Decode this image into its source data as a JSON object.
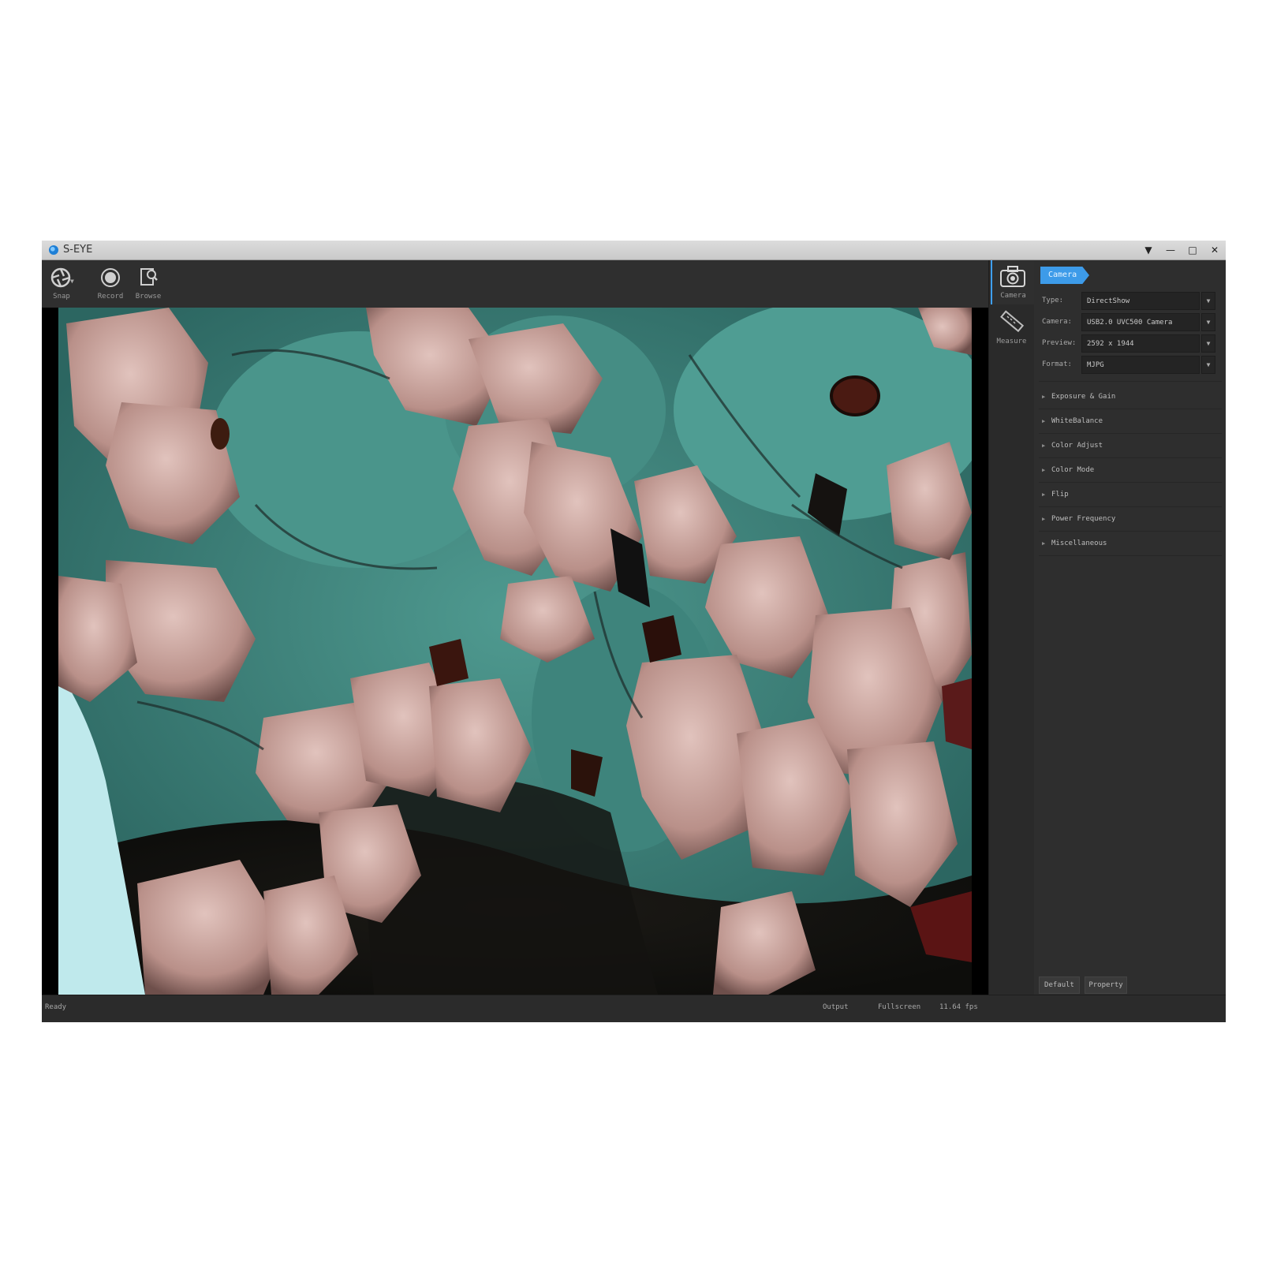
{
  "window": {
    "title": "S-EYE",
    "controls": [
      "▼",
      "—",
      "□",
      "✕"
    ]
  },
  "toolbar": {
    "snap_label": "Snap",
    "record_label": "Record",
    "browse_label": "Browse"
  },
  "nav": {
    "camera_label": "Camera",
    "measure_label": "Measure"
  },
  "panel": {
    "tab_label": "Camera",
    "fields": [
      {
        "key": "Type:",
        "value": "DirectShow"
      },
      {
        "key": "Camera:",
        "value": "USB2.0 UVC500 Camera"
      },
      {
        "key": "Preview:",
        "value": "2592 x 1944"
      },
      {
        "key": "Format:",
        "value": "MJPG"
      }
    ],
    "sections": [
      "Exposure & Gain",
      "WhiteBalance",
      "Color Adjust",
      "Color Mode",
      "Flip",
      "Power Frequency",
      "Miscellaneous"
    ],
    "default_button": "Default",
    "property_button": "Property"
  },
  "status": {
    "left": "Ready",
    "output": "Output",
    "fullscreen": "Fullscreen",
    "fps": "11.64 fps"
  },
  "colors": {
    "accent": "#3d9be9",
    "window_bg": "#2c2c2c",
    "mineral_teal": "#3a7e77",
    "mineral_pink": "#c9a49d"
  }
}
